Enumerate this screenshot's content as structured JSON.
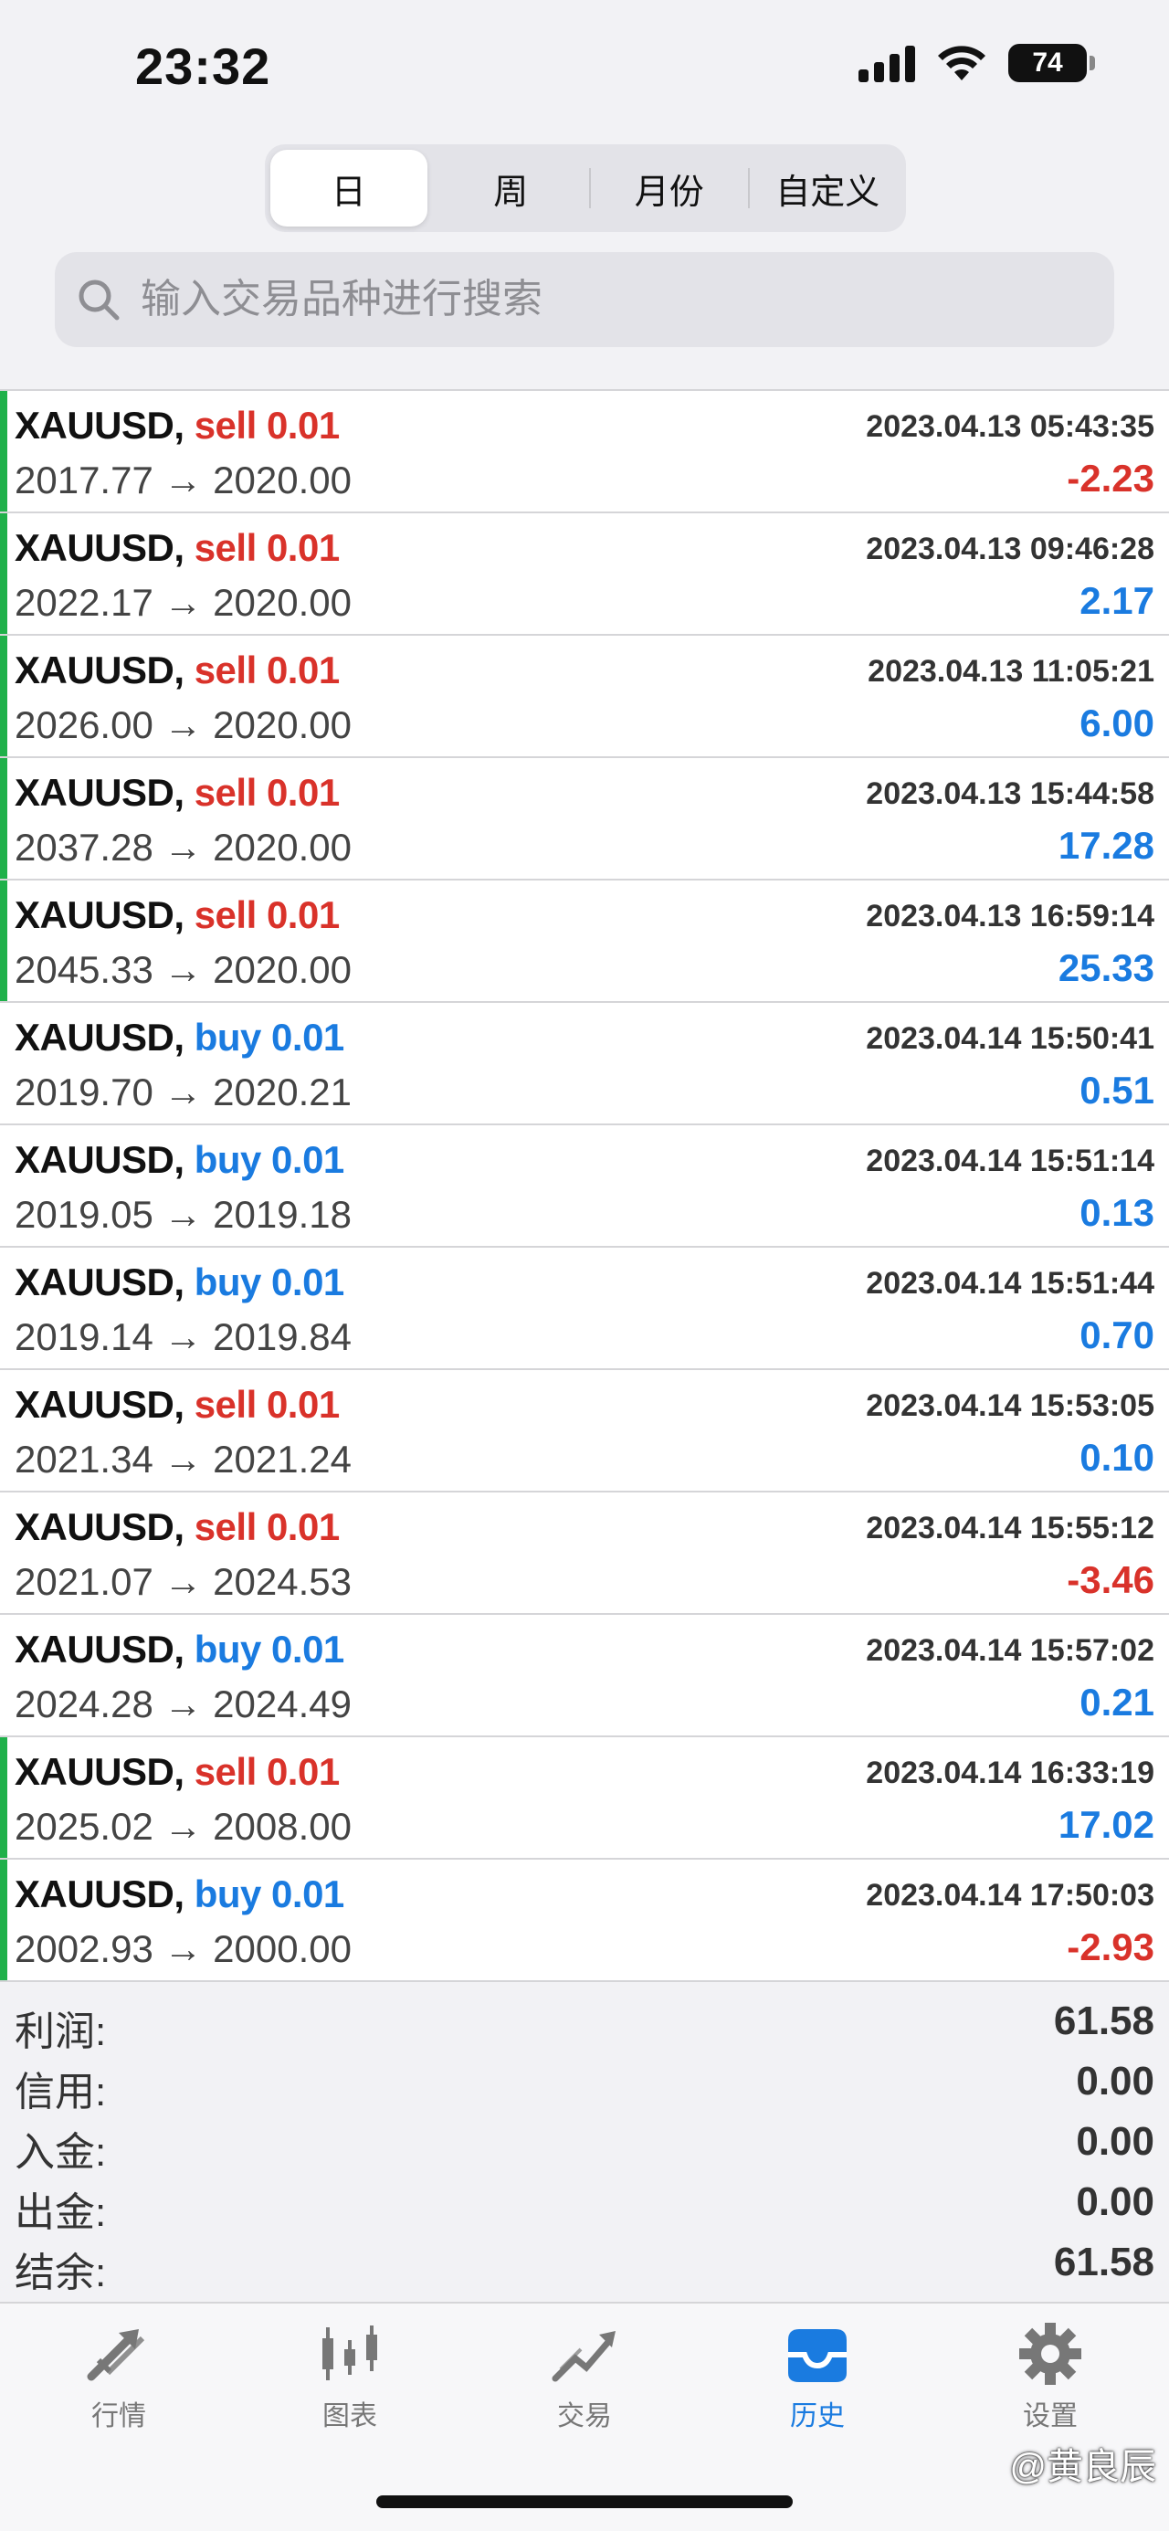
{
  "status": {
    "time": "23:32",
    "battery": "74"
  },
  "segments": [
    "日",
    "周",
    "月份",
    "自定义"
  ],
  "search": {
    "placeholder": "输入交易品种进行搜索"
  },
  "trades": [
    {
      "symbol": "XAUUSD,",
      "side": "sell",
      "qty": "0.01",
      "open": "2017.77",
      "close": "2020.00",
      "time": "2023.04.13 05:43:35",
      "profit": "-2.23",
      "accent": true
    },
    {
      "symbol": "XAUUSD,",
      "side": "sell",
      "qty": "0.01",
      "open": "2022.17",
      "close": "2020.00",
      "time": "2023.04.13 09:46:28",
      "profit": "2.17",
      "accent": true
    },
    {
      "symbol": "XAUUSD,",
      "side": "sell",
      "qty": "0.01",
      "open": "2026.00",
      "close": "2020.00",
      "time": "2023.04.13 11:05:21",
      "profit": "6.00",
      "accent": true
    },
    {
      "symbol": "XAUUSD,",
      "side": "sell",
      "qty": "0.01",
      "open": "2037.28",
      "close": "2020.00",
      "time": "2023.04.13 15:44:58",
      "profit": "17.28",
      "accent": true
    },
    {
      "symbol": "XAUUSD,",
      "side": "sell",
      "qty": "0.01",
      "open": "2045.33",
      "close": "2020.00",
      "time": "2023.04.13 16:59:14",
      "profit": "25.33",
      "accent": true
    },
    {
      "symbol": "XAUUSD,",
      "side": "buy",
      "qty": "0.01",
      "open": "2019.70",
      "close": "2020.21",
      "time": "2023.04.14 15:50:41",
      "profit": "0.51",
      "accent": false
    },
    {
      "symbol": "XAUUSD,",
      "side": "buy",
      "qty": "0.01",
      "open": "2019.05",
      "close": "2019.18",
      "time": "2023.04.14 15:51:14",
      "profit": "0.13",
      "accent": false
    },
    {
      "symbol": "XAUUSD,",
      "side": "buy",
      "qty": "0.01",
      "open": "2019.14",
      "close": "2019.84",
      "time": "2023.04.14 15:51:44",
      "profit": "0.70",
      "accent": false
    },
    {
      "symbol": "XAUUSD,",
      "side": "sell",
      "qty": "0.01",
      "open": "2021.34",
      "close": "2021.24",
      "time": "2023.04.14 15:53:05",
      "profit": "0.10",
      "accent": false
    },
    {
      "symbol": "XAUUSD,",
      "side": "sell",
      "qty": "0.01",
      "open": "2021.07",
      "close": "2024.53",
      "time": "2023.04.14 15:55:12",
      "profit": "-3.46",
      "accent": false
    },
    {
      "symbol": "XAUUSD,",
      "side": "buy",
      "qty": "0.01",
      "open": "2024.28",
      "close": "2024.49",
      "time": "2023.04.14 15:57:02",
      "profit": "0.21",
      "accent": false
    },
    {
      "symbol": "XAUUSD,",
      "side": "sell",
      "qty": "0.01",
      "open": "2025.02",
      "close": "2008.00",
      "time": "2023.04.14 16:33:19",
      "profit": "17.02",
      "accent": true
    },
    {
      "symbol": "XAUUSD,",
      "side": "buy",
      "qty": "0.01",
      "open": "2002.93",
      "close": "2000.00",
      "time": "2023.04.14 17:50:03",
      "profit": "-2.93",
      "accent": true
    }
  ],
  "summary": [
    {
      "label": "利润:",
      "value": "61.58"
    },
    {
      "label": "信用:",
      "value": "0.00"
    },
    {
      "label": "入金:",
      "value": "0.00"
    },
    {
      "label": "出金:",
      "value": "0.00"
    },
    {
      "label": "结余:",
      "value": "61.58"
    }
  ],
  "tabs": [
    {
      "label": "行情",
      "icon": "quotes-icon"
    },
    {
      "label": "图表",
      "icon": "chart-icon"
    },
    {
      "label": "交易",
      "icon": "trade-icon"
    },
    {
      "label": "历史",
      "icon": "history-icon",
      "active": true
    },
    {
      "label": "设置",
      "icon": "settings-icon"
    }
  ],
  "watermark": "@黄良辰",
  "colors": {
    "sell": "#d9322a",
    "buy": "#1a7be0",
    "accent": "#1fb14a"
  }
}
